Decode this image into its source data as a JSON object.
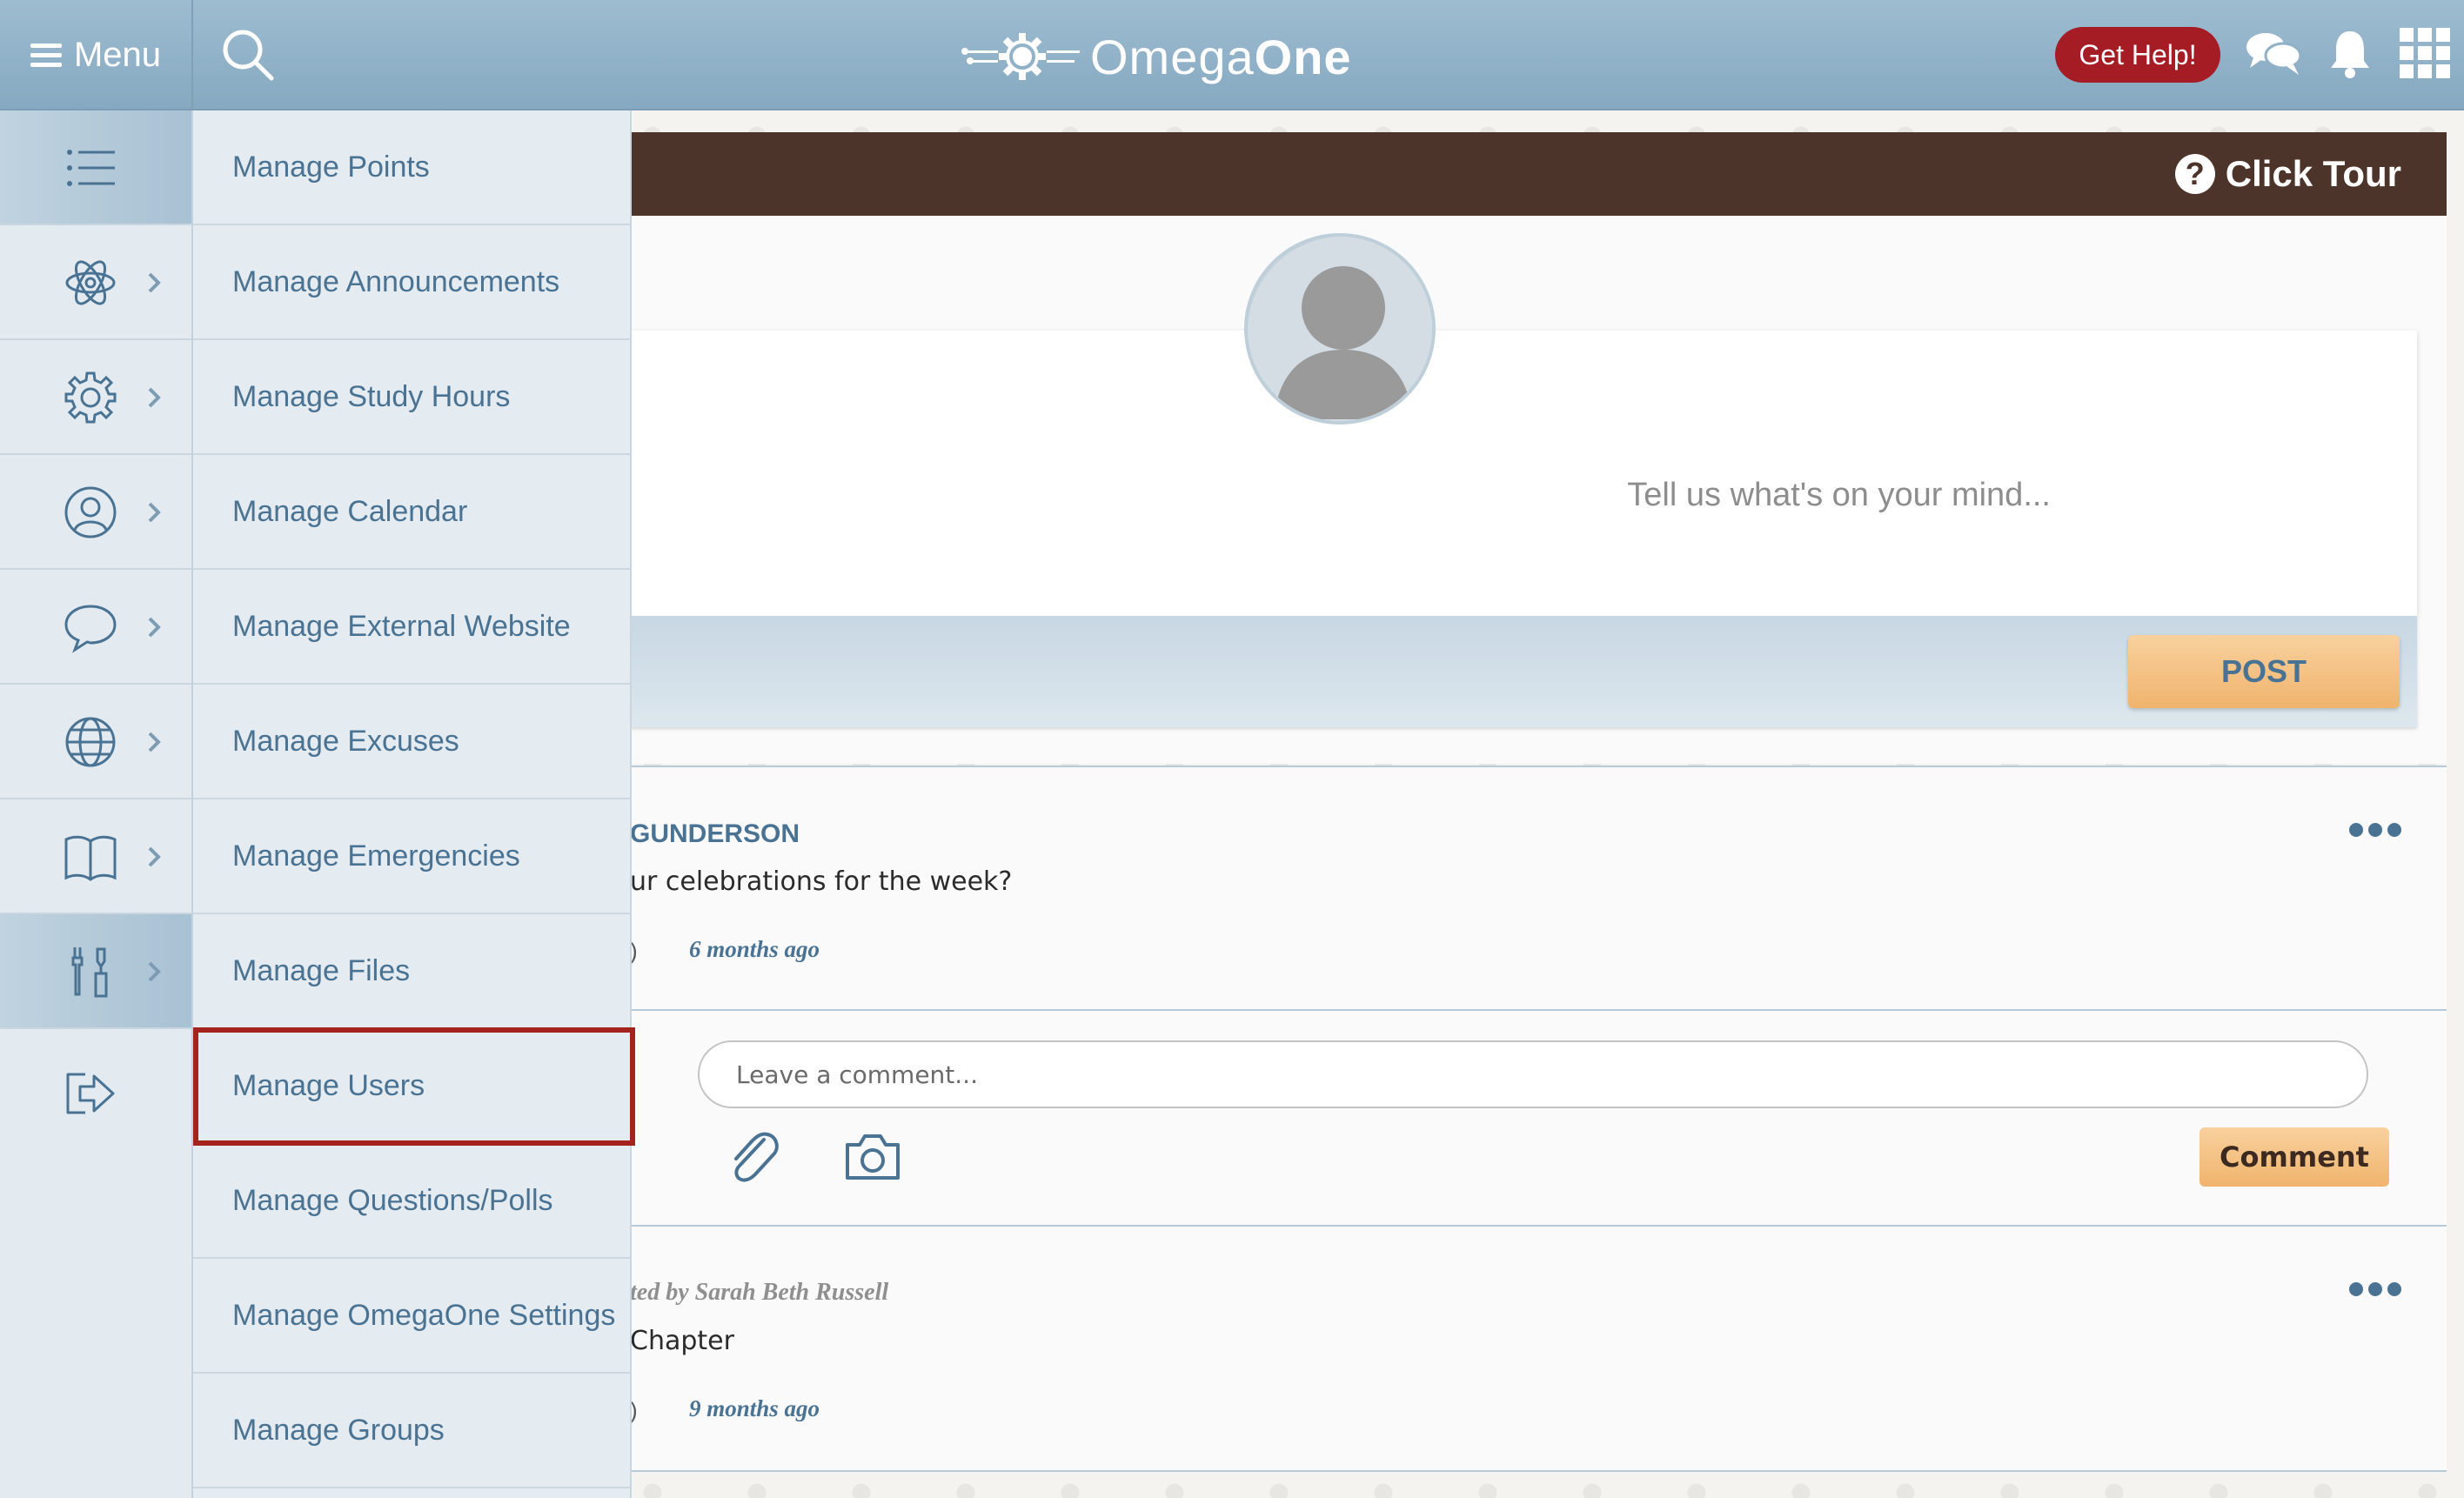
{
  "header": {
    "menu_label": "Menu",
    "logo_text_light": "Omega",
    "logo_text_bold": "One",
    "help_label": "Get Help!",
    "icons": [
      "search-icon",
      "chat-icon",
      "bell-icon",
      "apps-grid-icon"
    ]
  },
  "rail": {
    "items": [
      {
        "icon": "list-icon"
      },
      {
        "icon": "atom-icon"
      },
      {
        "icon": "gear-icon"
      },
      {
        "icon": "user-circle-icon"
      },
      {
        "icon": "speech-bubble-icon"
      },
      {
        "icon": "globe-icon"
      },
      {
        "icon": "open-book-icon"
      },
      {
        "icon": "tools-icon"
      },
      {
        "icon": "logout-icon"
      }
    ]
  },
  "submenu": {
    "items": [
      {
        "label": "Manage Points"
      },
      {
        "label": "Manage Announcements"
      },
      {
        "label": "Manage Study Hours"
      },
      {
        "label": "Manage Calendar"
      },
      {
        "label": "Manage External Website"
      },
      {
        "label": "Manage Excuses"
      },
      {
        "label": "Manage Emergencies"
      },
      {
        "label": "Manage Files"
      },
      {
        "label": "Manage Users"
      },
      {
        "label": "Manage Questions/Polls"
      },
      {
        "label": "Manage OmegaOne Settings"
      },
      {
        "label": "Manage Groups"
      }
    ],
    "highlighted": "Manage Users"
  },
  "banner": {
    "tour_label": "Click Tour"
  },
  "composer": {
    "placeholder": "Tell us what's on your mind...",
    "post_label": "POST"
  },
  "feed": [
    {
      "author": "GUNDERSON",
      "text": "ur celebrations for the week?",
      "meta": ")",
      "time": "6 months ago"
    },
    {
      "author": "ted by Sarah Beth Russell",
      "text": "Chapter",
      "meta": ")",
      "time": "9 months ago"
    }
  ],
  "comment": {
    "placeholder": "Leave a comment...",
    "button_label": "Comment"
  },
  "colors": {
    "header": "#8fb0c7",
    "banner": "#4c342a",
    "accent": "#4a7393",
    "highlight": "#a5231d",
    "button": "#f3c084"
  }
}
